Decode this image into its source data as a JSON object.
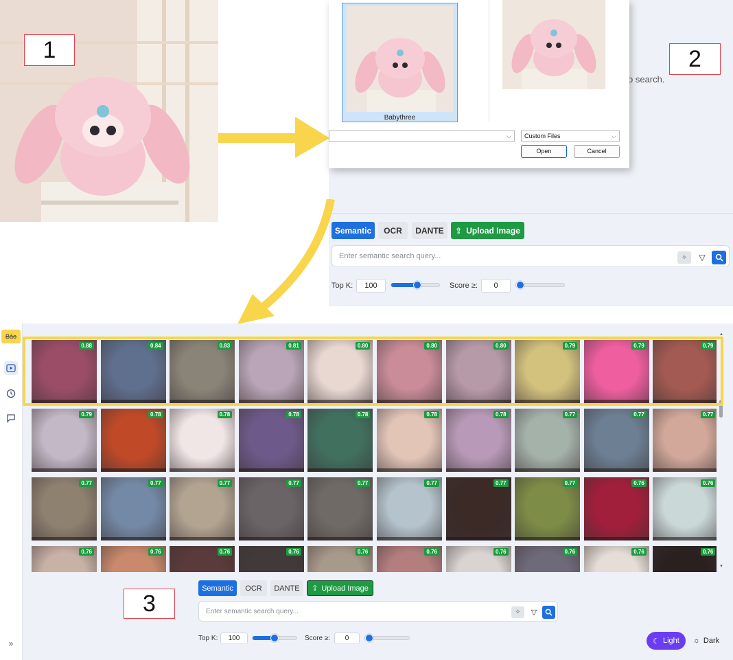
{
  "callouts": [
    "1",
    "2",
    "3"
  ],
  "file_dialog": {
    "selected_file": "Babythree",
    "file_type": "Custom Files",
    "open_label": "Open",
    "cancel_label": "Cancel",
    "behind_text": "o search."
  },
  "search_top": {
    "modes": [
      "Semantic",
      "OCR",
      "DANTE"
    ],
    "upload_label": "Upload Image",
    "placeholder": "Enter semantic search query...",
    "topk_label": "Top K:",
    "topk_value": "100",
    "topk_slider_fraction": 0.55,
    "score_label": "Score ≥:",
    "score_value": "0",
    "score_slider_fraction": 0.0
  },
  "sidebar": {
    "user_badge": "Bảo",
    "expand_label": "»"
  },
  "results": {
    "scores": [
      [
        "0.88",
        "0.84",
        "0.83",
        "0.81",
        "0.80",
        "0.80",
        "0.80",
        "0.79",
        "0.79",
        "0.79"
      ],
      [
        "0.79",
        "0.78",
        "0.78",
        "0.78",
        "0.78",
        "0.78",
        "0.78",
        "0.77",
        "0.77",
        "0.77"
      ],
      [
        "0.77",
        "0.77",
        "0.77",
        "0.77",
        "0.77",
        "0.77",
        "0.77",
        "0.77",
        "0.76",
        "0.76"
      ],
      [
        "0.76",
        "0.76",
        "0.76",
        "0.76",
        "0.76",
        "0.76",
        "0.76",
        "0.76",
        "0.76",
        "0.76"
      ]
    ],
    "colors": [
      [
        "#9b4d68",
        "#5f6f8e",
        "#8a8478",
        "#b9a5b7",
        "#e9d8d2",
        "#c98c98",
        "#b79aa8",
        "#d3c27e",
        "#ef5fa0",
        "#a35a52"
      ],
      [
        "#c2b8c6",
        "#c04a28",
        "#f1e6e6",
        "#6e5a8a",
        "#41705f",
        "#e3c5b8",
        "#b89ab8",
        "#a5b2aa",
        "#6c7f93",
        "#d2a89a"
      ],
      [
        "#8f8170",
        "#7489a6",
        "#b3a492",
        "#6b6466",
        "#6f6a66",
        "#b4c3cc",
        "#3b2a26",
        "#7d8c46",
        "#a11f3a",
        "#cbd8d8"
      ],
      [
        "#c7b2a5",
        "#c8896c",
        "#5a3a3a",
        "#423a3a",
        "#a89a8a",
        "#b57e7e",
        "#d9d4d2",
        "#6f6a7a",
        "#e5ddd6",
        "#2a2020"
      ]
    ]
  },
  "search_bottom": {
    "modes": [
      "Semantic",
      "OCR",
      "DANTE"
    ],
    "upload_label": "Upload Image",
    "placeholder": "Enter semantic search query...",
    "topk_label": "Top K:",
    "topk_value": "100",
    "topk_slider_fraction": 0.5,
    "score_label": "Score ≥:",
    "score_value": "0",
    "score_slider_fraction": 0.0
  },
  "theme": {
    "light_label": "Light",
    "dark_label": "Dark",
    "active_color": "#6b3df2"
  }
}
